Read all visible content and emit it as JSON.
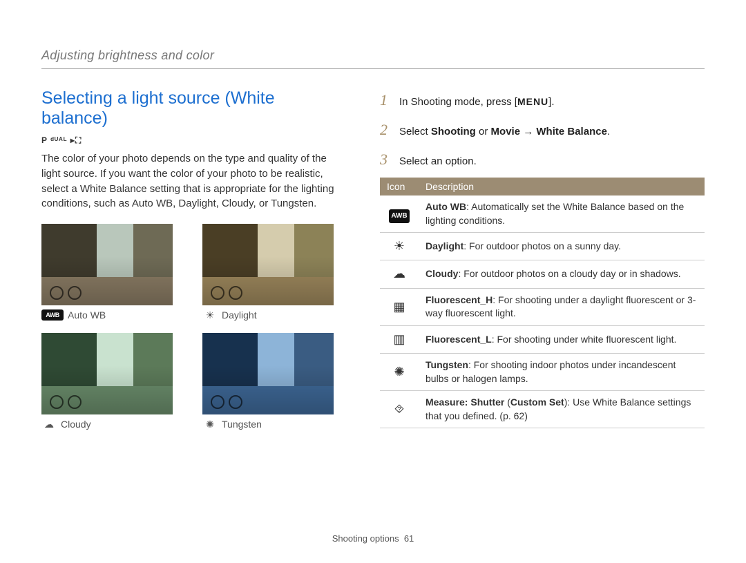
{
  "section_header": "Adjusting brightness and color",
  "title": "Selecting a light source (White balance)",
  "mode_icons": "P  ᵈᵁᴬᴸ  ▸⛶",
  "intro": "The color of your photo depends on the type and quality of the light source. If you want the color of your photo to be realistic, select a White Balance setting that is appropriate for the lighting conditions, such as Auto WB, Daylight, Cloudy, or Tungsten.",
  "thumbs": {
    "autowb": {
      "label": "Auto WB",
      "icon": "AWB"
    },
    "daylight": {
      "label": "Daylight",
      "icon": "☀"
    },
    "cloudy": {
      "label": "Cloudy",
      "icon": "☁"
    },
    "tungsten": {
      "label": "Tungsten",
      "icon": "✺"
    }
  },
  "steps": {
    "s1_a": "In Shooting mode, press [",
    "s1_key": "MENU",
    "s1_b": "].",
    "s2_a": "Select ",
    "s2_strong": "Shooting",
    "s2_b": " or ",
    "s2_strong2": "Movie",
    "s2_arrow": " → ",
    "s2_strong3": "White Balance",
    "s2_end": ".",
    "s3": "Select an option."
  },
  "table": {
    "header_icon": "Icon",
    "header_desc": "Description",
    "rows": [
      {
        "icon": "AWB",
        "iconType": "box",
        "term": "Auto WB",
        "desc": ": Automatically set the White Balance based on the lighting conditions."
      },
      {
        "icon": "☀",
        "iconType": "glyph",
        "term": "Daylight",
        "desc": ": For outdoor photos on a sunny day."
      },
      {
        "icon": "☁",
        "iconType": "glyph",
        "term": "Cloudy",
        "desc": ": For outdoor photos on a cloudy day or in shadows."
      },
      {
        "icon": "▦",
        "iconType": "glyph",
        "term": "Fluorescent_H",
        "desc": ": For shooting under a daylight fluorescent or 3-way fluorescent light."
      },
      {
        "icon": "▥",
        "iconType": "glyph",
        "term": "Fluorescent_L",
        "desc": ": For shooting under white fluorescent light."
      },
      {
        "icon": "✺",
        "iconType": "glyph",
        "term": "Tungsten",
        "desc": ": For shooting indoor photos under incandescent bulbs or halogen lamps."
      },
      {
        "icon": "⯑",
        "iconType": "glyph",
        "term": "Measure: Shutter",
        "term2": "Custom Set",
        "desc": ": Use White Balance settings that you defined. (p. 62)"
      }
    ]
  },
  "footer_label": "Shooting options",
  "footer_page": "61"
}
